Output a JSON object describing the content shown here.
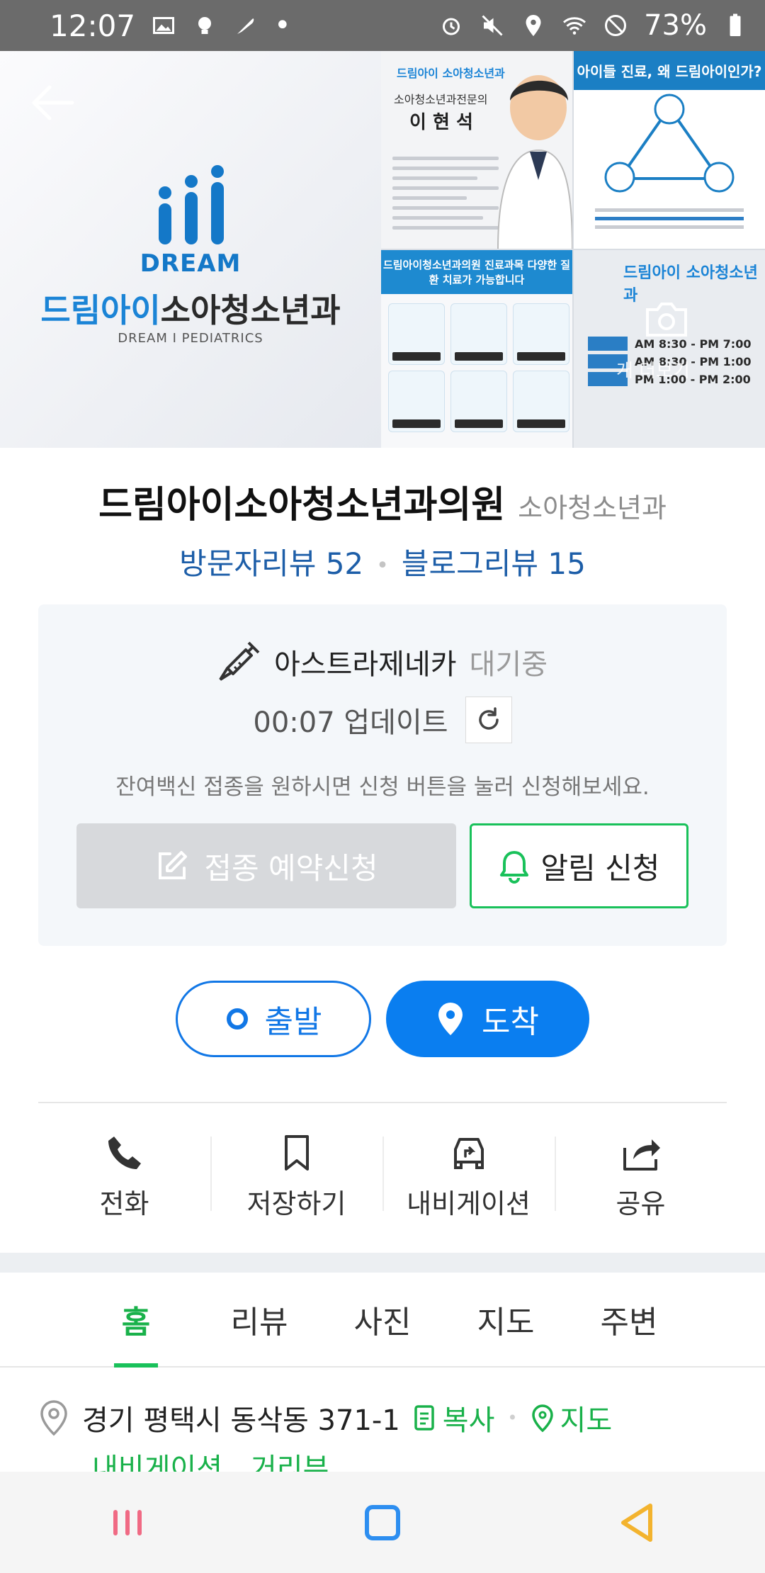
{
  "status_bar": {
    "time": "12:07",
    "battery": "73%"
  },
  "gallery": {
    "main": {
      "dream": "DREAM",
      "name_blue": "드림아이",
      "name_dark": "소아청소년과",
      "sub": "DREAM I PEDIATRICS"
    },
    "tile1": {
      "brand": "드림아이 소아청소년과",
      "heading": "소아청소년과전문의",
      "doctor": "이 현 석"
    },
    "tile2": {
      "heading": "아이들 진료, 왜 드림아이인가?"
    },
    "tile3": {
      "heading": "드림아이청소년과의원 진료과목 다양한 질환 치료가 가능합니다"
    },
    "tile4": {
      "brand": "드림아이 소아청소년과",
      "hours": [
        "AM 8:30 - PM 7:00",
        "AM 8:30 - PM 1:00",
        "PM 1:00 - PM 2:00"
      ],
      "more_label": "개 더보기"
    }
  },
  "place": {
    "name": "드림아이소아청소년과의원",
    "category": "소아청소년과"
  },
  "reviews": {
    "visitor": "방문자리뷰 52",
    "blog": "블로그리뷰 15"
  },
  "vaccine": {
    "name": "아스트라제네카",
    "status": "대기중",
    "updated": "00:07 업데이트",
    "note": "잔여백신 접종을 원하시면 신청 버튼을 눌러 신청해보세요.",
    "reserve_label": "접종 예약신청",
    "alert_label": "알림 신청"
  },
  "route": {
    "depart": "출발",
    "arrive": "도착"
  },
  "actions": {
    "call": "전화",
    "save": "저장하기",
    "navigate": "내비게이션",
    "share": "공유"
  },
  "tabs": [
    "홈",
    "리뷰",
    "사진",
    "지도",
    "주변"
  ],
  "address": {
    "text": "경기 평택시 동삭동 371-1",
    "copy": "복사",
    "map": "지도",
    "navigate": "내비게이션",
    "distance": "거리뷰"
  },
  "colors": {
    "green": "#19c15a",
    "blue": "#0a7ef0",
    "link_blue": "#1d5ea8"
  }
}
